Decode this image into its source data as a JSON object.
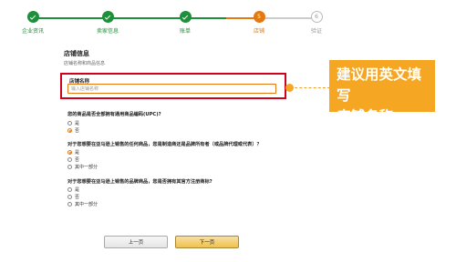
{
  "stepper": {
    "steps": [
      {
        "label": "企业资讯",
        "status": "done"
      },
      {
        "label": "卖家信息",
        "status": "done"
      },
      {
        "label": "账单",
        "status": "done"
      },
      {
        "label": "店铺",
        "status": "current",
        "number": "5"
      },
      {
        "label": "验证",
        "status": "todo",
        "number": "6"
      }
    ],
    "colors": {
      "done": "#1e8f3a",
      "current": "#e47911",
      "todo": "#bbbbbb"
    }
  },
  "form": {
    "title": "店铺信息",
    "subtitle": "店铺名称和商品信息",
    "store_name_label": "店铺名称",
    "store_name_placeholder": "输入店铺名称",
    "store_name_value": "",
    "q1": "您的商品是否全部拥有通用商品编码(UPC)?",
    "q1_options": [
      "是",
      "否"
    ],
    "q1_selected": 1,
    "q2": "对于您想要在亚马逊上销售的任何商品，您是制造商还是品牌所有者（或品牌代理或代表）？",
    "q2_options": [
      "是",
      "否",
      "其中一部分"
    ],
    "q2_selected": 0,
    "q3": "对于您想要在亚马逊上销售的品牌商品，您是否拥有其官方注册商标?",
    "q3_options": [
      "是",
      "否",
      "其中一部分"
    ],
    "q3_selected": -1
  },
  "callout": {
    "line1": "建议用英文填写",
    "line2": "店铺名称",
    "color": "#f5a623",
    "highlight_color": "#d0021b"
  },
  "buttons": {
    "prev": "上一页",
    "next": "下一页"
  }
}
